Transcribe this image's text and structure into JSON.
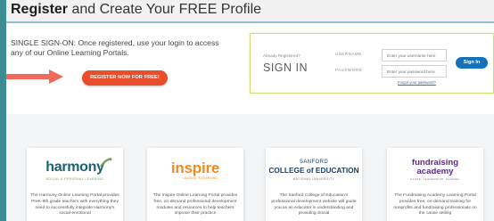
{
  "header": {
    "title_bold": "Register",
    "title_rest": " and Create Your FREE Profile"
  },
  "sso": {
    "text": "SINGLE SIGN-ON: Once registered, use your login to access any of our Online Learning Portals.",
    "register_button": "REGISTER NOW FOR FREE!"
  },
  "signin": {
    "already_label": "Already Registered?",
    "heading": "SIGN IN",
    "username_label": "USERNAME",
    "username_placeholder": "Enter your username here",
    "password_label": "PASSWORD",
    "password_placeholder": "Enter your password here",
    "forgot_link": "Forgot your password?",
    "button": "Sign In"
  },
  "portals": [
    {
      "logo": "harmony",
      "logo_sub": "SOCIAL & PERSONAL LEARNING",
      "description": "The Harmony Online Learning Portal provides PreK-6th grade teachers with everything they need to successfully integrate Harmony's social-emotional"
    },
    {
      "logo": "inspire",
      "logo_sub": "LEADING IN LEARNING",
      "description": "The Inspire Online Learning Portal provides free, on-demand professional development modules and resources to help teachers improve their practice"
    },
    {
      "logo_line1": "SANFORD",
      "logo_line2": "COLLEGE of EDUCATION",
      "logo_sub": "NATIONAL UNIVERSITY",
      "description": "The Sanford College of Education's professional development website will guide you as an educator in understanding and providing Social"
    },
    {
      "logo_line1": "fundraising",
      "logo_line2": "academy",
      "logo_sub": "CAUSE. LEADERSHIP. CHANGE.",
      "description": "The Fundraising Academy Learning Portal provides free, on-demand training for nonprofits and fundraising professionals on the cause selling"
    }
  ],
  "colors": {
    "accent_teal": "#3e8c93",
    "register_orange": "#ea4d2a",
    "signin_blue": "#1372b9",
    "panel_border": "#c9e07a",
    "arrow": "#f06a5a"
  }
}
